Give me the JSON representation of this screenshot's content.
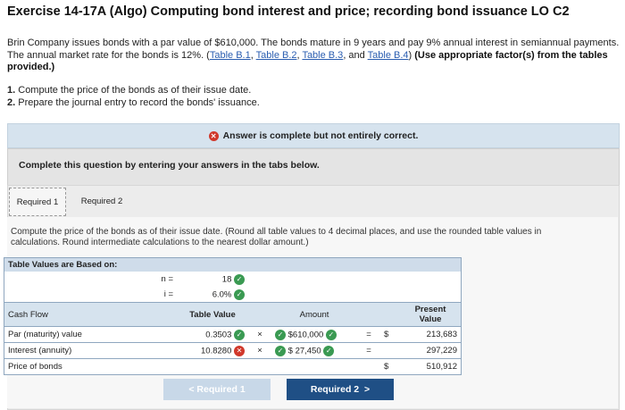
{
  "title": "Exercise 14-17A (Algo) Computing bond interest and price; recording bond issuance LO C2",
  "intro": {
    "text1": "Brin Company issues bonds with a par value of $610,000. The bonds mature in 9 years and pay 9% annual interest in semiannual payments. The annual market rate for the bonds is 12%. (",
    "links": [
      "Table B.1",
      "Table B.2",
      "Table B.3",
      "Table B.4"
    ],
    "sep1": ", ",
    "sep2": ", ",
    "sep3": ", and ",
    "text2": ") ",
    "bold": "(Use appropriate factor(s) from the tables provided.)"
  },
  "steps": [
    {
      "num": "1.",
      "text": " Compute the price of the bonds as of their issue date."
    },
    {
      "num": "2.",
      "text": " Prepare the journal entry to record the bonds' issuance."
    }
  ],
  "banner": "Answer is complete but not entirely correct.",
  "complete_prompt": "Complete this question by entering your answers in the tabs below.",
  "tabs": [
    "Required 1",
    "Required 2"
  ],
  "instructions": "Compute the price of the bonds as of their issue date. (Round all table values to 4 decimal places, and use the rounded table values in calculations. Round intermediate calculations to the nearest dollar amount.)",
  "table": {
    "header": "Table Values are Based on:",
    "n_label": "n =",
    "n_value": "18",
    "i_label": "i =",
    "i_value": "6.0%",
    "col_cashflow": "Cash Flow",
    "col_table_value": "Table Value",
    "col_amount": "Amount",
    "col_pv": "Present Value",
    "rows": [
      {
        "label": "Par (maturity) value",
        "table_value": "0.3503",
        "tv_status": "correct",
        "op": "×",
        "amount": "$610,000",
        "eq": "=",
        "dollar": "$",
        "pv": "213,683"
      },
      {
        "label": "Interest (annuity)",
        "table_value": "10.8280",
        "tv_status": "incorrect",
        "op": "×",
        "amount": "$ 27,450",
        "eq": "=",
        "dollar": "",
        "pv": "297,229"
      },
      {
        "label": "Price of bonds",
        "table_value": "",
        "op": "",
        "amount": "",
        "eq": "",
        "dollar": "$",
        "pv": "510,912"
      }
    ]
  },
  "nav": {
    "prev": "Required 1",
    "next": "Required 2"
  },
  "icons": {
    "check": "check-icon",
    "cross": "cross-icon"
  }
}
